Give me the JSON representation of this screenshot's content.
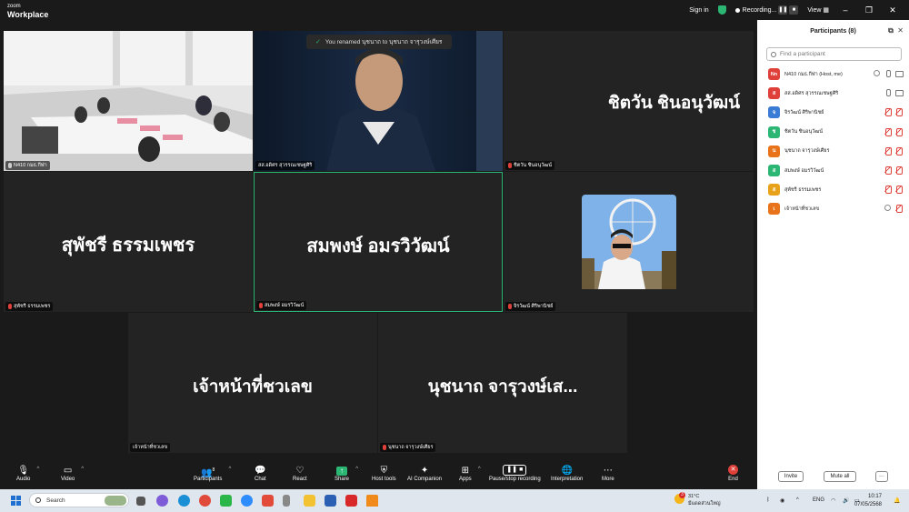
{
  "app": {
    "logo_line1": "zoom",
    "logo_line2": "Workplace"
  },
  "titlebar": {
    "signin": "Sign in",
    "recording": "Recording...",
    "view": "View"
  },
  "toast": {
    "text": "You renamed นุชนาถ to นุชนาถ จารุวงษ์เศียร"
  },
  "tiles": [
    {
      "id": "room",
      "tag": "N410 กมธ.กีฬา",
      "mic": "on"
    },
    {
      "id": "speaker",
      "tag": "สส.อดิศร สุวรรณเชษฐศิริ",
      "mic": "on"
    },
    {
      "id": "chitwan",
      "name": "ชิตวัน ชินอนุวัฒน์",
      "tag": "ชิตวัน ชินอนุวัฒน์",
      "mic": "off"
    },
    {
      "id": "supatcharee",
      "name": "สุพัชรี ธรรมเพชร",
      "tag": "สุพัชรี ธรรมเพชร",
      "mic": "off"
    },
    {
      "id": "sompong",
      "name": "สมพงษ์ อมรวิวัฒน์",
      "tag": "สมพงษ์ อมรวิวัฒน์",
      "mic": "off"
    },
    {
      "id": "jirawat",
      "tag": "จิรวัฒน์ ศิริพานิชย์",
      "mic": "off"
    },
    {
      "id": "staff",
      "name": "เจ้าหน้าที่ชวเลข",
      "tag": "เจ้าหน้าที่ชวเลข",
      "mic": "none"
    },
    {
      "id": "nutchanat",
      "name": "นุชนาถ จารุวงษ์เส...",
      "tag": "นุชนาถ จารุวงษ์เศียร",
      "mic": "off"
    }
  ],
  "panel": {
    "title": "Participants (8)",
    "search_placeholder": "Find a participant",
    "participants": [
      {
        "initials": "Nn",
        "color": "#e0403a",
        "name": "N410 กมธ.กีฬา (Host, me)",
        "mic": "on",
        "cam": "on",
        "host": true
      },
      {
        "initials": "ส",
        "color": "#e0403a",
        "name": "สส.อดิศร สุวรรณเชษฐศิริ",
        "mic": "on",
        "cam": "on",
        "host": false
      },
      {
        "initials": "จ",
        "color": "#3a7bd5",
        "name": "จิรวัฒน์ ศิริพานิชย์",
        "mic": "off",
        "cam": "off",
        "host": false
      },
      {
        "initials": "ช",
        "color": "#2bb673",
        "name": "ชิตวัน ชินอนุวัฒน์",
        "mic": "off",
        "cam": "off",
        "host": false
      },
      {
        "initials": "น",
        "color": "#e8731a",
        "name": "นุชนาถ จารุวงษ์เศียร",
        "mic": "off",
        "cam": "off",
        "host": false
      },
      {
        "initials": "ส",
        "color": "#2bb673",
        "name": "สมพงษ์ อมรวิวัฒน์",
        "mic": "off",
        "cam": "off",
        "host": false
      },
      {
        "initials": "ส",
        "color": "#e8a21a",
        "name": "สุพัชรี ธรรมเพชร",
        "mic": "off",
        "cam": "off",
        "host": false
      },
      {
        "initials": "เ",
        "color": "#e8731a",
        "name": "เจ้าหน้าที่ชวเลข",
        "mic": "none",
        "cam": "off",
        "host": false
      }
    ],
    "invite": "Invite",
    "mute_all": "Mute all",
    "more": "···"
  },
  "toolbar": {
    "audio": "Audio",
    "video": "Video",
    "participants": "Participants",
    "participants_count": "8",
    "chat": "Chat",
    "react": "React",
    "share": "Share",
    "host_tools": "Host tools",
    "ai": "AI Companion",
    "apps": "Apps",
    "pause": "Pause/stop recording",
    "interpretation": "Interpretation",
    "more": "More",
    "end": "End"
  },
  "taskbar": {
    "search": "Search",
    "temp": "31°C",
    "weather": "มีแดดส่วนใหญ่",
    "lang": "ENG",
    "time": "10:17",
    "date": "07/05/2568",
    "weather_badge": "3"
  }
}
